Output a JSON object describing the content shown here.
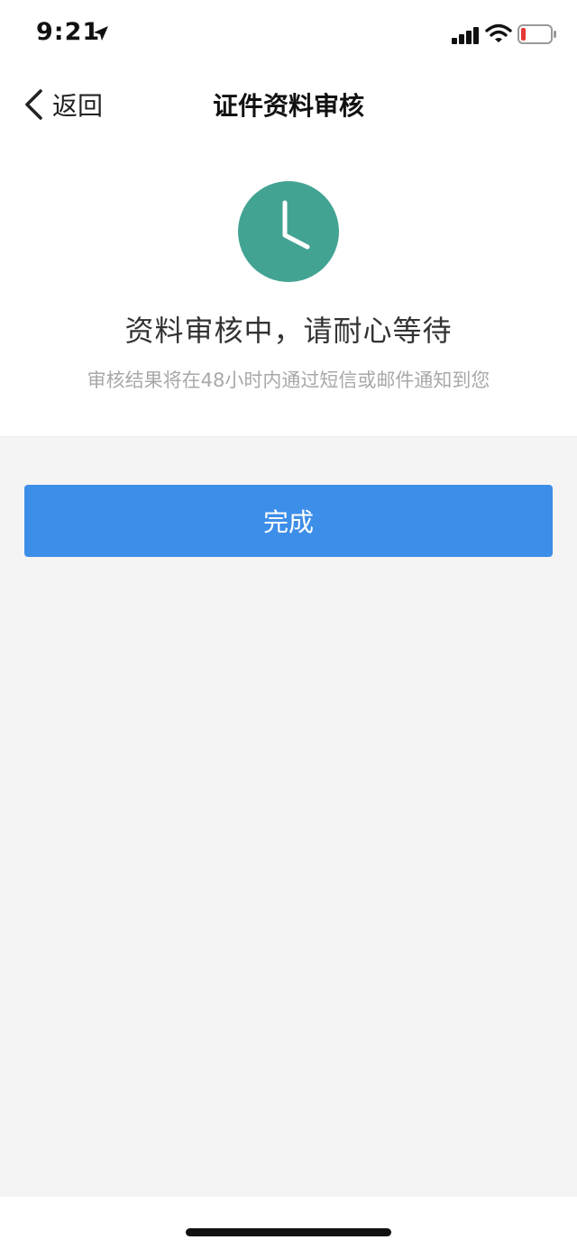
{
  "status_bar": {
    "time": "9:21",
    "icons": [
      "location-arrow-icon",
      "cellular-signal-icon",
      "wifi-icon",
      "battery-low-icon"
    ],
    "battery_color": "#e53935"
  },
  "nav": {
    "back_label": "返回",
    "title": "证件资料审核"
  },
  "review": {
    "icon": "clock-icon",
    "icon_color": "#43a393",
    "message": "资料审核中，请耐心等待",
    "note": "审核结果将在48小时内通过短信或邮件通知到您"
  },
  "actions": {
    "done_label": "完成",
    "done_color": "#3d8ee8"
  }
}
